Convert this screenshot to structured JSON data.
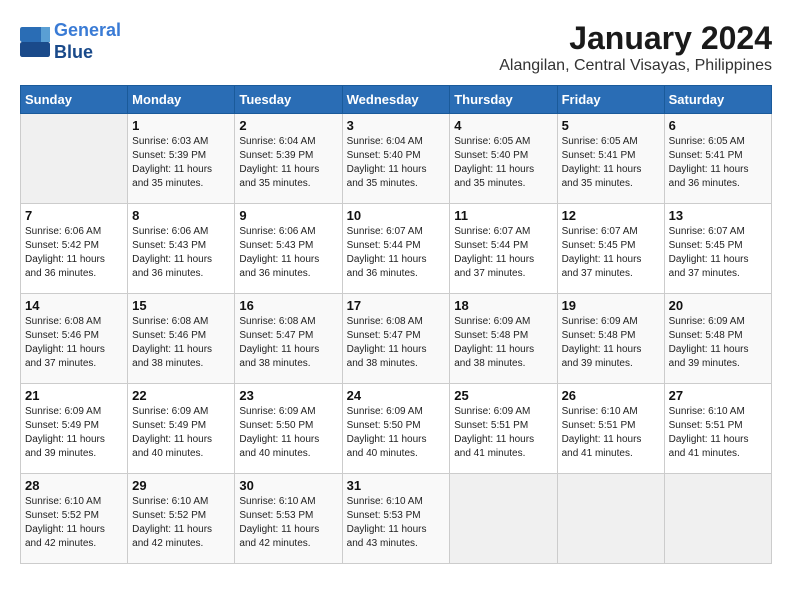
{
  "header": {
    "logo_line1": "General",
    "logo_line2": "Blue",
    "month": "January 2024",
    "location": "Alangilan, Central Visayas, Philippines"
  },
  "days_of_week": [
    "Sunday",
    "Monday",
    "Tuesday",
    "Wednesday",
    "Thursday",
    "Friday",
    "Saturday"
  ],
  "weeks": [
    [
      {
        "day": "",
        "sunrise": "",
        "sunset": "",
        "daylight": ""
      },
      {
        "day": "1",
        "sunrise": "Sunrise: 6:03 AM",
        "sunset": "Sunset: 5:39 PM",
        "daylight": "Daylight: 11 hours and 35 minutes."
      },
      {
        "day": "2",
        "sunrise": "Sunrise: 6:04 AM",
        "sunset": "Sunset: 5:39 PM",
        "daylight": "Daylight: 11 hours and 35 minutes."
      },
      {
        "day": "3",
        "sunrise": "Sunrise: 6:04 AM",
        "sunset": "Sunset: 5:40 PM",
        "daylight": "Daylight: 11 hours and 35 minutes."
      },
      {
        "day": "4",
        "sunrise": "Sunrise: 6:05 AM",
        "sunset": "Sunset: 5:40 PM",
        "daylight": "Daylight: 11 hours and 35 minutes."
      },
      {
        "day": "5",
        "sunrise": "Sunrise: 6:05 AM",
        "sunset": "Sunset: 5:41 PM",
        "daylight": "Daylight: 11 hours and 35 minutes."
      },
      {
        "day": "6",
        "sunrise": "Sunrise: 6:05 AM",
        "sunset": "Sunset: 5:41 PM",
        "daylight": "Daylight: 11 hours and 36 minutes."
      }
    ],
    [
      {
        "day": "7",
        "sunrise": "Sunrise: 6:06 AM",
        "sunset": "Sunset: 5:42 PM",
        "daylight": "Daylight: 11 hours and 36 minutes."
      },
      {
        "day": "8",
        "sunrise": "Sunrise: 6:06 AM",
        "sunset": "Sunset: 5:43 PM",
        "daylight": "Daylight: 11 hours and 36 minutes."
      },
      {
        "day": "9",
        "sunrise": "Sunrise: 6:06 AM",
        "sunset": "Sunset: 5:43 PM",
        "daylight": "Daylight: 11 hours and 36 minutes."
      },
      {
        "day": "10",
        "sunrise": "Sunrise: 6:07 AM",
        "sunset": "Sunset: 5:44 PM",
        "daylight": "Daylight: 11 hours and 36 minutes."
      },
      {
        "day": "11",
        "sunrise": "Sunrise: 6:07 AM",
        "sunset": "Sunset: 5:44 PM",
        "daylight": "Daylight: 11 hours and 37 minutes."
      },
      {
        "day": "12",
        "sunrise": "Sunrise: 6:07 AM",
        "sunset": "Sunset: 5:45 PM",
        "daylight": "Daylight: 11 hours and 37 minutes."
      },
      {
        "day": "13",
        "sunrise": "Sunrise: 6:07 AM",
        "sunset": "Sunset: 5:45 PM",
        "daylight": "Daylight: 11 hours and 37 minutes."
      }
    ],
    [
      {
        "day": "14",
        "sunrise": "Sunrise: 6:08 AM",
        "sunset": "Sunset: 5:46 PM",
        "daylight": "Daylight: 11 hours and 37 minutes."
      },
      {
        "day": "15",
        "sunrise": "Sunrise: 6:08 AM",
        "sunset": "Sunset: 5:46 PM",
        "daylight": "Daylight: 11 hours and 38 minutes."
      },
      {
        "day": "16",
        "sunrise": "Sunrise: 6:08 AM",
        "sunset": "Sunset: 5:47 PM",
        "daylight": "Daylight: 11 hours and 38 minutes."
      },
      {
        "day": "17",
        "sunrise": "Sunrise: 6:08 AM",
        "sunset": "Sunset: 5:47 PM",
        "daylight": "Daylight: 11 hours and 38 minutes."
      },
      {
        "day": "18",
        "sunrise": "Sunrise: 6:09 AM",
        "sunset": "Sunset: 5:48 PM",
        "daylight": "Daylight: 11 hours and 38 minutes."
      },
      {
        "day": "19",
        "sunrise": "Sunrise: 6:09 AM",
        "sunset": "Sunset: 5:48 PM",
        "daylight": "Daylight: 11 hours and 39 minutes."
      },
      {
        "day": "20",
        "sunrise": "Sunrise: 6:09 AM",
        "sunset": "Sunset: 5:48 PM",
        "daylight": "Daylight: 11 hours and 39 minutes."
      }
    ],
    [
      {
        "day": "21",
        "sunrise": "Sunrise: 6:09 AM",
        "sunset": "Sunset: 5:49 PM",
        "daylight": "Daylight: 11 hours and 39 minutes."
      },
      {
        "day": "22",
        "sunrise": "Sunrise: 6:09 AM",
        "sunset": "Sunset: 5:49 PM",
        "daylight": "Daylight: 11 hours and 40 minutes."
      },
      {
        "day": "23",
        "sunrise": "Sunrise: 6:09 AM",
        "sunset": "Sunset: 5:50 PM",
        "daylight": "Daylight: 11 hours and 40 minutes."
      },
      {
        "day": "24",
        "sunrise": "Sunrise: 6:09 AM",
        "sunset": "Sunset: 5:50 PM",
        "daylight": "Daylight: 11 hours and 40 minutes."
      },
      {
        "day": "25",
        "sunrise": "Sunrise: 6:09 AM",
        "sunset": "Sunset: 5:51 PM",
        "daylight": "Daylight: 11 hours and 41 minutes."
      },
      {
        "day": "26",
        "sunrise": "Sunrise: 6:10 AM",
        "sunset": "Sunset: 5:51 PM",
        "daylight": "Daylight: 11 hours and 41 minutes."
      },
      {
        "day": "27",
        "sunrise": "Sunrise: 6:10 AM",
        "sunset": "Sunset: 5:51 PM",
        "daylight": "Daylight: 11 hours and 41 minutes."
      }
    ],
    [
      {
        "day": "28",
        "sunrise": "Sunrise: 6:10 AM",
        "sunset": "Sunset: 5:52 PM",
        "daylight": "Daylight: 11 hours and 42 minutes."
      },
      {
        "day": "29",
        "sunrise": "Sunrise: 6:10 AM",
        "sunset": "Sunset: 5:52 PM",
        "daylight": "Daylight: 11 hours and 42 minutes."
      },
      {
        "day": "30",
        "sunrise": "Sunrise: 6:10 AM",
        "sunset": "Sunset: 5:53 PM",
        "daylight": "Daylight: 11 hours and 42 minutes."
      },
      {
        "day": "31",
        "sunrise": "Sunrise: 6:10 AM",
        "sunset": "Sunset: 5:53 PM",
        "daylight": "Daylight: 11 hours and 43 minutes."
      },
      {
        "day": "",
        "sunrise": "",
        "sunset": "",
        "daylight": ""
      },
      {
        "day": "",
        "sunrise": "",
        "sunset": "",
        "daylight": ""
      },
      {
        "day": "",
        "sunrise": "",
        "sunset": "",
        "daylight": ""
      }
    ]
  ]
}
